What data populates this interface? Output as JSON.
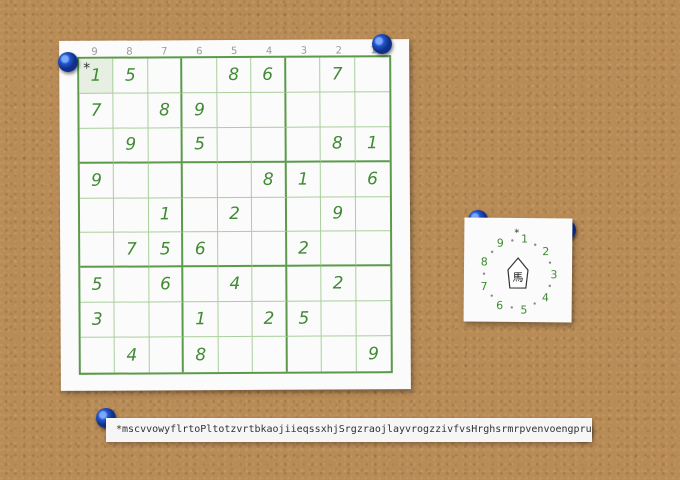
{
  "sudoku": {
    "column_labels": [
      "9",
      "8",
      "7",
      "6",
      "5",
      "4",
      "3",
      "2",
      "1"
    ],
    "selected_marker": "*",
    "grid": [
      [
        "1",
        "5",
        "",
        "",
        "8",
        "6",
        "",
        "7",
        ""
      ],
      [
        "7",
        "",
        "8",
        "9",
        "",
        "",
        "",
        "",
        ""
      ],
      [
        "",
        "9",
        "",
        "5",
        "",
        "",
        "",
        "8",
        "1"
      ],
      [
        "9",
        "",
        "",
        "",
        "",
        "8",
        "1",
        "",
        "6"
      ],
      [
        "",
        "",
        "1",
        "",
        "2",
        "",
        "",
        "9",
        ""
      ],
      [
        "",
        "7",
        "5",
        "6",
        "",
        "",
        "2",
        "",
        ""
      ],
      [
        "5",
        "",
        "6",
        "",
        "4",
        "",
        "",
        "2",
        ""
      ],
      [
        "3",
        "",
        "",
        "1",
        "",
        "2",
        "5",
        "",
        ""
      ],
      [
        "",
        "4",
        "",
        "8",
        "",
        "",
        "",
        "",
        "9"
      ]
    ]
  },
  "piece_note": {
    "piece_glyph": "馬",
    "ring_numbers": [
      "1",
      "2",
      "3",
      "4",
      "5",
      "6",
      "7",
      "8",
      "9"
    ],
    "marker": "*"
  },
  "move_strip": {
    "text": "*mscvvowyflrtoPltotzvrtbkaojiieqssxhjSrgzraojlayvrogzzivfvsHrghsrmrpvenvoengprupe"
  }
}
